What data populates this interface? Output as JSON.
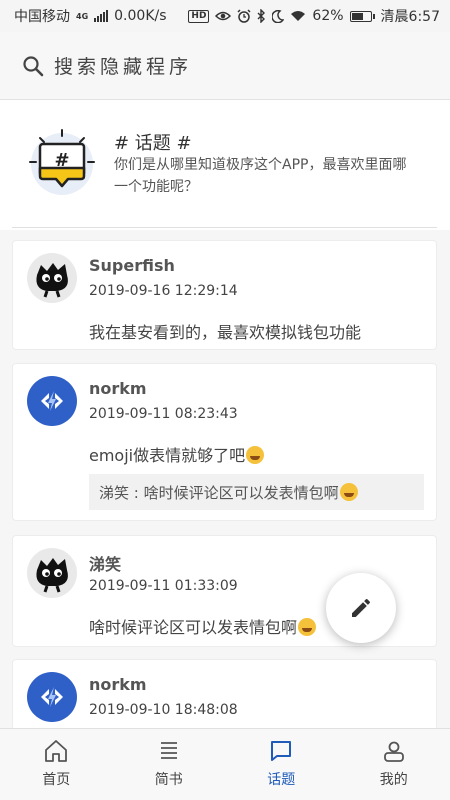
{
  "status_bar": {
    "carrier": "中国移动",
    "network": "4G",
    "speed": "0.00K/s",
    "hd": "HD",
    "battery": "62%",
    "battery_level": 0.62,
    "time": "清晨6:57"
  },
  "search": {
    "placeholder": "搜索隐藏程序",
    "icon": "search-icon"
  },
  "topic": {
    "title": "# 话题 #",
    "description": "你们是从哪里知道极序这个APP，最喜欢里面哪一个功能呢？",
    "icon_glyph": "#",
    "icon_accent": "#f5c518"
  },
  "comments": [
    {
      "user": "Superfish",
      "time": "2019-09-16 12:29:14",
      "text": "我在基安看到的，最喜欢模拟钱包功能",
      "avatar": "black-creature-avatar"
    },
    {
      "user": "norkm",
      "time": "2019-09-11 08:23:43",
      "text": "emoji做表情就够了吧",
      "reply": "涕笑 : 啥时候评论区可以发表情包啊",
      "avatar": "blue-logo-avatar"
    },
    {
      "user": "涕笑",
      "time": "2019-09-11 01:33:09",
      "text": "啥时候评论区可以发表情包啊",
      "avatar": "black-creature-avatar"
    },
    {
      "user": "norkm",
      "time": "2019-09-10 18:48:08",
      "avatar": "blue-logo-avatar"
    }
  ],
  "fab": {
    "icon": "pencil-icon"
  },
  "nav": {
    "items": [
      {
        "label": "首页",
        "icon": "home-icon"
      },
      {
        "label": "简书",
        "icon": "list-icon"
      },
      {
        "label": "话题",
        "icon": "chat-icon"
      },
      {
        "label": "我的",
        "icon": "profile-icon"
      }
    ],
    "active_index": 2,
    "active_color": "#1f5bb8"
  }
}
